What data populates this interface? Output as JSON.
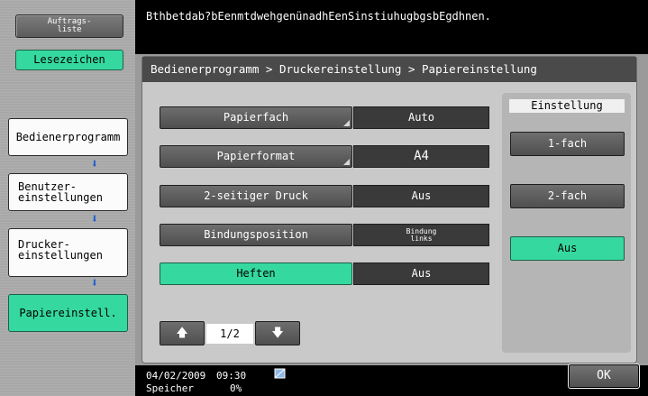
{
  "sidebar": {
    "job_list_label": "Auftrags-\nliste",
    "bookmark_label": "Lesezeichen",
    "nav_items": [
      {
        "label": "Bedienerprogramm"
      },
      {
        "label": "Benutzer-\neinstellungen"
      },
      {
        "label": "Drucker-\neinstellungen"
      },
      {
        "label": "Papiereinstell."
      }
    ]
  },
  "message": "Bthbetdab?bEenmtdwehgenünadhEenSinstiuhugbgsbEgdhnen.",
  "breadcrumb": "Bedienerprogramm > Druckereinstellung > Papiereinstellung",
  "settings_rows": [
    {
      "label": "Papierfach",
      "value": "Auto"
    },
    {
      "label": "Papierformat",
      "value": "A4"
    },
    {
      "label": "2-seitiger Druck",
      "value": "Aus"
    },
    {
      "label": "Bindungsposition",
      "value": "Bindung\nlinks"
    },
    {
      "label": "Heften",
      "value": "Aus"
    }
  ],
  "einstellung": {
    "header": "Einstellung",
    "options": [
      "1-fach",
      "2-fach",
      "Aus"
    ],
    "selected": "Aus"
  },
  "pager": {
    "current": "1/2",
    "up_icon": "arrow-up-icon",
    "down_icon": "arrow-down-icon"
  },
  "status": {
    "date": "04/02/2009",
    "time": "09:30",
    "memory_label": "Speicher",
    "memory_value": "0%"
  },
  "ok_label": "OK",
  "colors": {
    "accent": "#35d9a0",
    "arrow": "#1f5fd0"
  }
}
